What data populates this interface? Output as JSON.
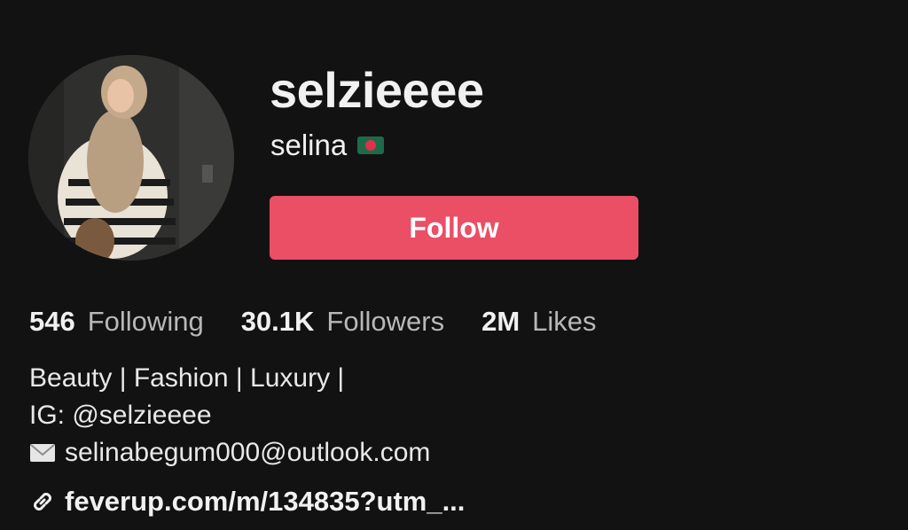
{
  "profile": {
    "username": "selzieeee",
    "display_name": "selina",
    "flag_icon": "bangladesh-flag-icon",
    "follow_label": "Follow",
    "accent_color": "#ea4f66"
  },
  "stats": [
    {
      "value": "546",
      "label": "Following"
    },
    {
      "value": "30.1K",
      "label": "Followers"
    },
    {
      "value": "2M",
      "label": "Likes"
    }
  ],
  "bio": {
    "line1": "Beauty | Fashion | Luxury |",
    "line2": "IG: @selzieeee",
    "email_icon": "envelope-icon",
    "email": "selinabegum000@outlook.com"
  },
  "link": {
    "icon": "link-icon",
    "text": "feverup.com/m/134835?utm_..."
  }
}
